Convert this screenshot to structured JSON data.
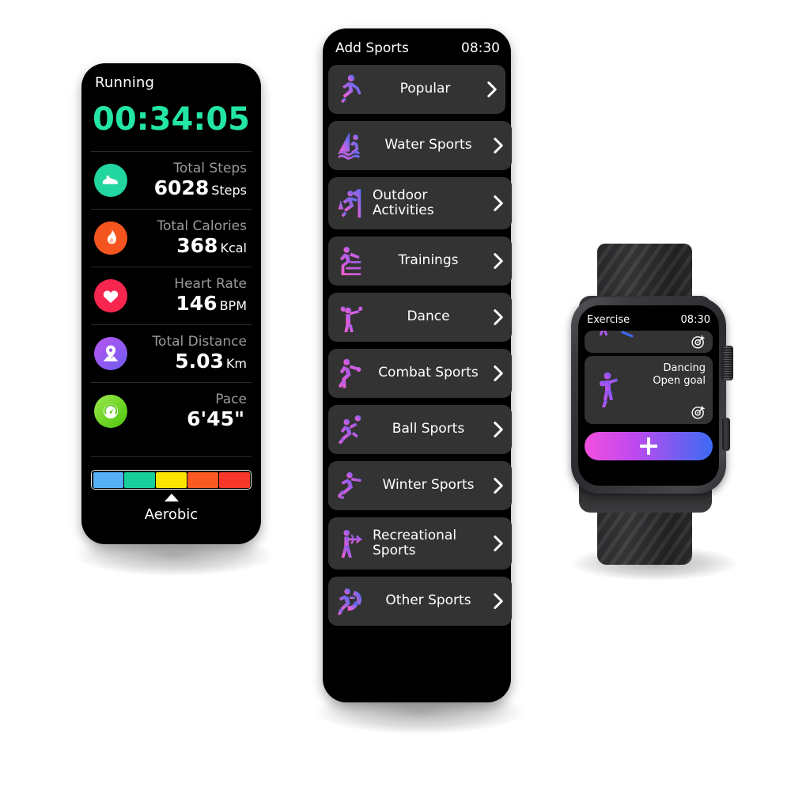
{
  "running_panel": {
    "title": "Running",
    "timer": "00:34:05",
    "timer_color": "#23e5a4",
    "metrics": [
      {
        "icon": "sneaker-icon",
        "icon_color": "#22d6a0",
        "label": "Total Steps",
        "value": "6028",
        "unit": "Steps"
      },
      {
        "icon": "flame-icon",
        "icon_color": "#f4551f",
        "label": "Total Calories",
        "value": "368",
        "unit": "Kcal"
      },
      {
        "icon": "heart-icon",
        "icon_color": "#f6264f",
        "label": "Heart Rate",
        "value": "146",
        "unit": "BPM"
      },
      {
        "icon": "location-pin-icon",
        "icon_color": "#9b45e8",
        "label": "Total Distance",
        "value": "5.03",
        "unit": "Km"
      },
      {
        "icon": "speedometer-icon",
        "icon_color": "#6fd419",
        "label": "Pace",
        "value": "6'45\"",
        "unit": ""
      }
    ],
    "zone_bar": {
      "segments": [
        "#55b0f5",
        "#18ce9a",
        "#fce400",
        "#fb5a22",
        "#f6372a"
      ],
      "active_index": 2,
      "active_label": "Aerobic"
    }
  },
  "add_sports_panel": {
    "title": "Add Sports",
    "time": "08:30",
    "items": [
      {
        "label": "Popular",
        "icon": "running-person-icon"
      },
      {
        "label": "Water Sports",
        "icon": "windsurfing-icon"
      },
      {
        "label": "Outdoor\nActivities",
        "icon": "rock-climbing-icon"
      },
      {
        "label": "Trainings",
        "icon": "stair-climber-icon"
      },
      {
        "label": "Dance",
        "icon": "dancer-icon"
      },
      {
        "label": "Combat Sports",
        "icon": "boxing-icon"
      },
      {
        "label": "Ball Sports",
        "icon": "volleyball-icon"
      },
      {
        "label": "Winter Sports",
        "icon": "ice-skating-icon"
      },
      {
        "label": "Recreational\nSports",
        "icon": "archery-icon"
      },
      {
        "label": "Other Sports",
        "icon": "jump-rope-icon"
      }
    ],
    "chevron": "chevron-right-icon"
  },
  "watch": {
    "screen": {
      "title": "Exercise",
      "time": "08:30",
      "cards": [
        {
          "name": "",
          "goal": "",
          "partial": true
        },
        {
          "name": "Dancing",
          "goal": "Open goal",
          "partial": false
        }
      ],
      "add_button": "+"
    }
  }
}
